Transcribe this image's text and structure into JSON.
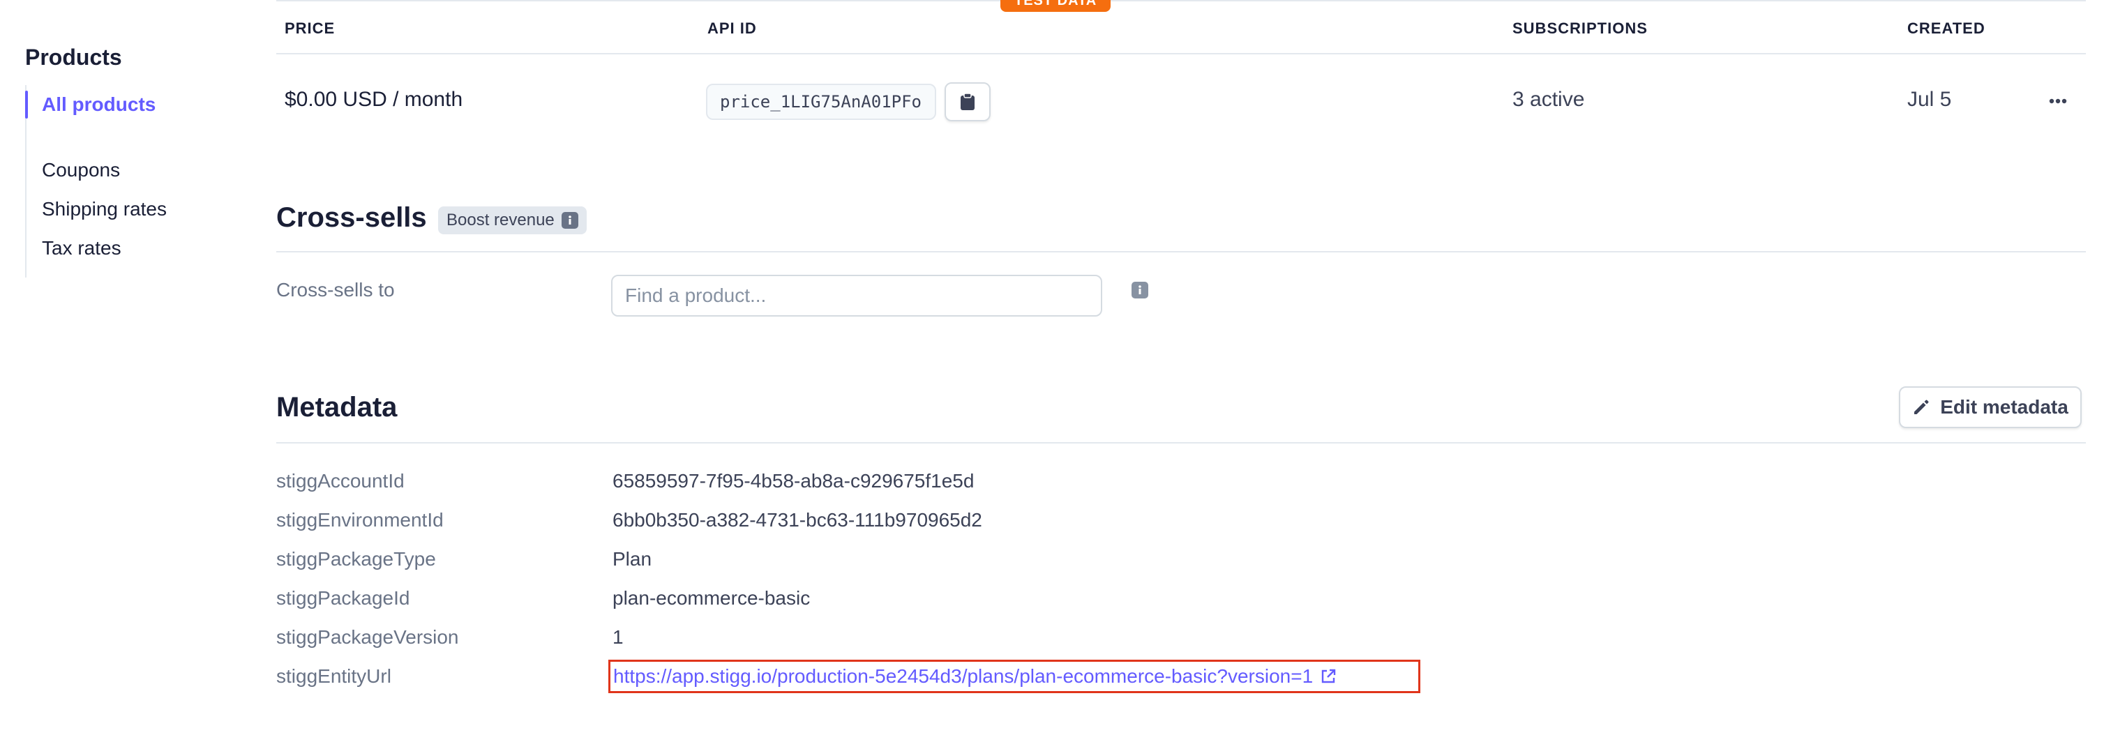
{
  "sidebar": {
    "title": "Products",
    "items": [
      {
        "label": "All products",
        "active": true
      },
      {
        "label": "Coupons"
      },
      {
        "label": "Shipping rates"
      },
      {
        "label": "Tax rates"
      }
    ]
  },
  "test_badge": "TEST DATA",
  "pricing": {
    "columns": [
      "PRICE",
      "API ID",
      "SUBSCRIPTIONS",
      "CREATED"
    ],
    "row": {
      "price": "$0.00 USD / month",
      "api_id": "price_1LIG75AnA01PFo",
      "subscriptions": "3 active",
      "created": "Jul 5"
    }
  },
  "cross_sells": {
    "title": "Cross-sells",
    "badge": "Boost revenue",
    "label": "Cross-sells to",
    "placeholder": "Find a product..."
  },
  "metadata": {
    "title": "Metadata",
    "edit_label": "Edit metadata",
    "rows": [
      {
        "key": "stiggAccountId",
        "value": "65859597-7f95-4b58-ab8a-c929675f1e5d"
      },
      {
        "key": "stiggEnvironmentId",
        "value": "6bb0b350-a382-4731-bc63-111b970965d2"
      },
      {
        "key": "stiggPackageType",
        "value": "Plan"
      },
      {
        "key": "stiggPackageId",
        "value": "plan-ecommerce-basic"
      },
      {
        "key": "stiggPackageVersion",
        "value": "1"
      },
      {
        "key": "stiggEntityUrl",
        "value": "https://app.stigg.io/production-5e2454d3/plans/plan-ecommerce-basic?version=1"
      }
    ]
  },
  "colors": {
    "accent": "#635bff",
    "highlight_border": "#e0351b",
    "test_badge": "#f56e0f"
  }
}
